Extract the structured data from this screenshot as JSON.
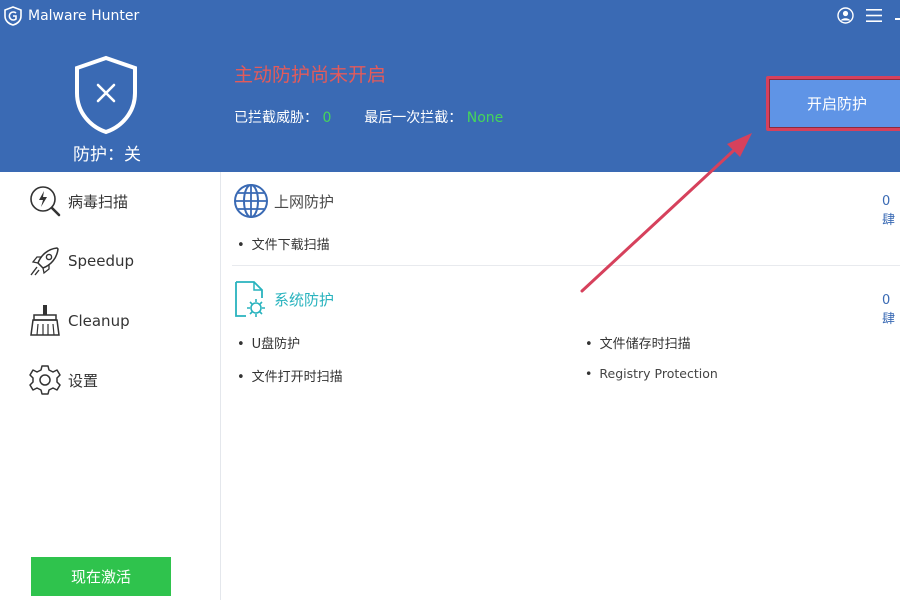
{
  "app": {
    "title": "Malware Hunter"
  },
  "header": {
    "protection_label": "防护：关",
    "headline": "主动防护尚未开启",
    "blocked_label": "已拦截威胁：",
    "blocked_count": "0",
    "last_block_label": "最后一次拦截：",
    "last_block_value": "None",
    "enable_button": "开启防护"
  },
  "sidebar": {
    "items": [
      {
        "label": "病毒扫描",
        "icon": "scan-icon"
      },
      {
        "label": "Speedup",
        "icon": "rocket-icon"
      },
      {
        "label": "Cleanup",
        "icon": "broom-icon"
      },
      {
        "label": "设置",
        "icon": "gear-icon"
      }
    ],
    "activate_button": "现在激活"
  },
  "main": {
    "web_protection": {
      "title": "上网防护",
      "count": "0 肆",
      "features": [
        "文件下载扫描"
      ]
    },
    "system_protection": {
      "title": "系统防护",
      "count": "0 肆",
      "features": [
        "U盘防护",
        "文件储存时扫描",
        "文件打开时扫描",
        "Registry Protection"
      ]
    }
  },
  "colors": {
    "header_bg": "#3a6ab4",
    "headline": "#e25b5b",
    "count_green": "#45d65a",
    "activate_green": "#2fc34d",
    "annotation_red": "#d6415c",
    "teal": "#29b3be"
  }
}
